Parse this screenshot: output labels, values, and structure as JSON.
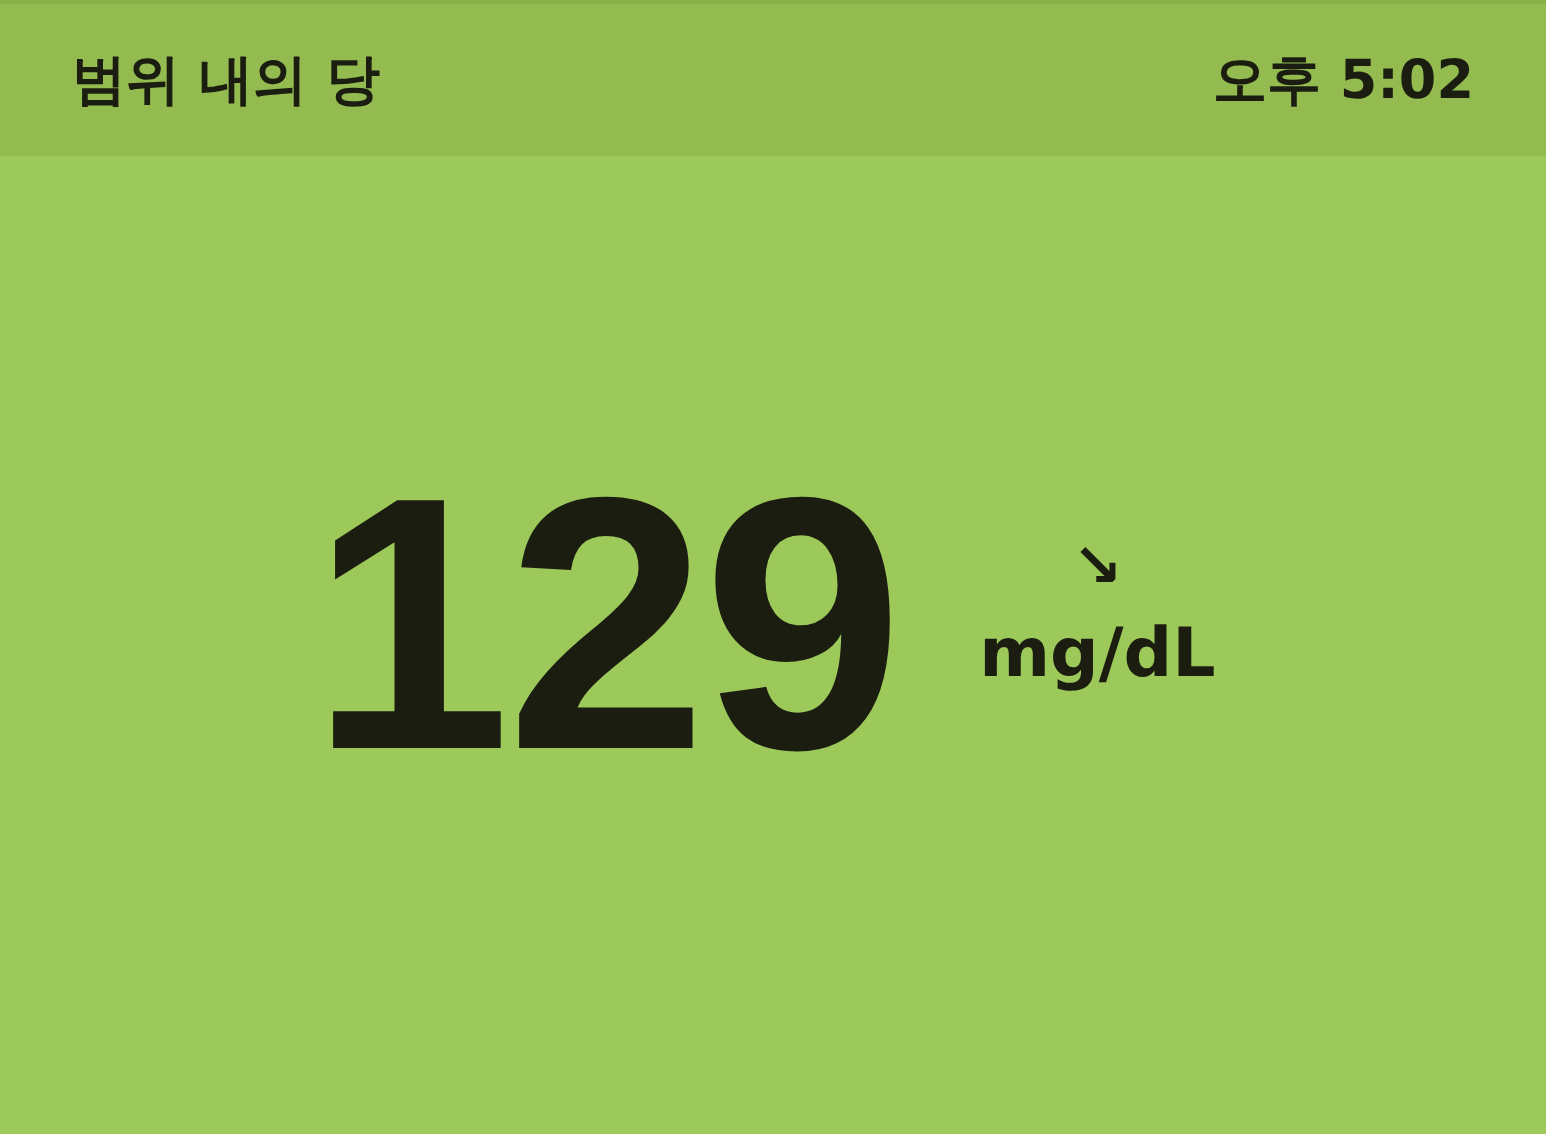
{
  "header": {
    "title": "범위 내의 당",
    "time": "오후 5:02"
  },
  "reading": {
    "value": "129",
    "trend_arrow": "↘",
    "unit": "mg/dL"
  }
}
